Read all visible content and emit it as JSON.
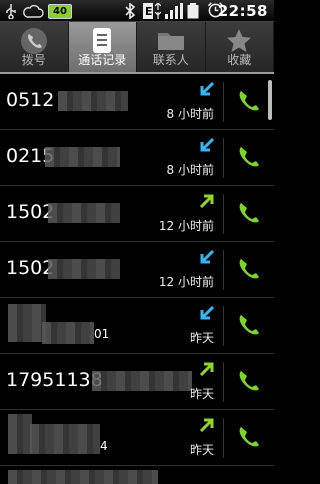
{
  "status_bar": {
    "battery": "40",
    "time": "22:58"
  },
  "tabs": [
    {
      "label": "拨号",
      "icon": "phone-icon"
    },
    {
      "label": "通话记录",
      "icon": "call-log-icon"
    },
    {
      "label": "联系人",
      "icon": "contacts-icon"
    },
    {
      "label": "收藏",
      "icon": "star-icon"
    }
  ],
  "calls": [
    {
      "number": "0512",
      "time": "8 小时前",
      "type": "incoming"
    },
    {
      "number": "0215",
      "time": "8 小时前",
      "type": "incoming"
    },
    {
      "number": "1502",
      "time": "12 小时前",
      "type": "outgoing"
    },
    {
      "number": "1502",
      "time": "12 小时前",
      "type": "incoming"
    },
    {
      "number": "01",
      "time": "昨天",
      "type": "incoming"
    },
    {
      "number": "17951138",
      "time": "昨天",
      "type": "outgoing"
    },
    {
      "number": "4",
      "time": "昨天",
      "type": "outgoing"
    }
  ],
  "colors": {
    "incoming_arrow": "#37b5f0",
    "outgoing_arrow": "#8fd62f",
    "call_button": "#7cd32a"
  }
}
